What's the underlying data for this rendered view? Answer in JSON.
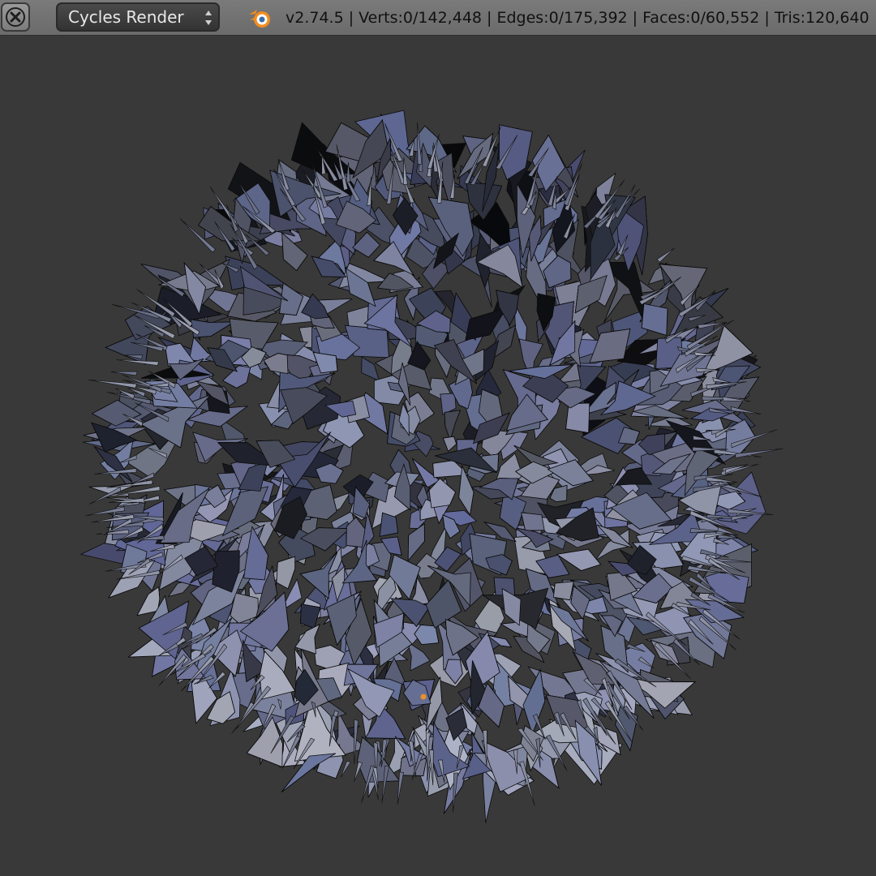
{
  "header": {
    "close_icon": "close-x-icon",
    "render_engine": {
      "selected": "Cycles Render"
    },
    "logo_icon": "blender-logo-icon",
    "stats": "v2.74.5 | Verts:0/142,448 | Edges:0/175,392 | Faces:0/60,552 | Tris:120,640"
  },
  "viewport": {
    "object": "shard-sphere",
    "background_color": "#393939",
    "shard_base_color": "#6f7382",
    "origin_marker_color": "#e8902a"
  }
}
